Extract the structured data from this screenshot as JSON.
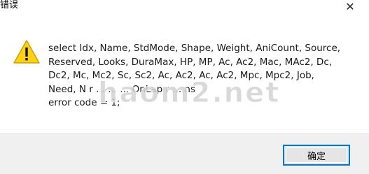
{
  "window": {
    "title": "错误",
    "close_glyph": "✕"
  },
  "icon": {
    "type": "warning-icon",
    "glyph": "!",
    "fill_color": "#fcd116",
    "stroke_color": "#c9a400"
  },
  "message": {
    "text": "select Idx, Name, StdMode, Shape, Weight, AniCount, Source,\nReserved, Looks, DuraMax, HP, MP, Ac, Ac2, Mac, MAc2, Dc,\nDc2, Mc, Mc2, Sc, Sc2, Ac, Ac2, Ac, Ac2, Mpc, Mpc2, Job,\nNeed, N     r ...        ...       ...  OnLap     r  ...  ns\nerror code = 1;"
  },
  "watermark": {
    "text": "haom2.net"
  },
  "buttons": {
    "ok_label": "确定"
  },
  "colors": {
    "footer_bg": "#f0f0f0",
    "accent": "#0078d7"
  }
}
